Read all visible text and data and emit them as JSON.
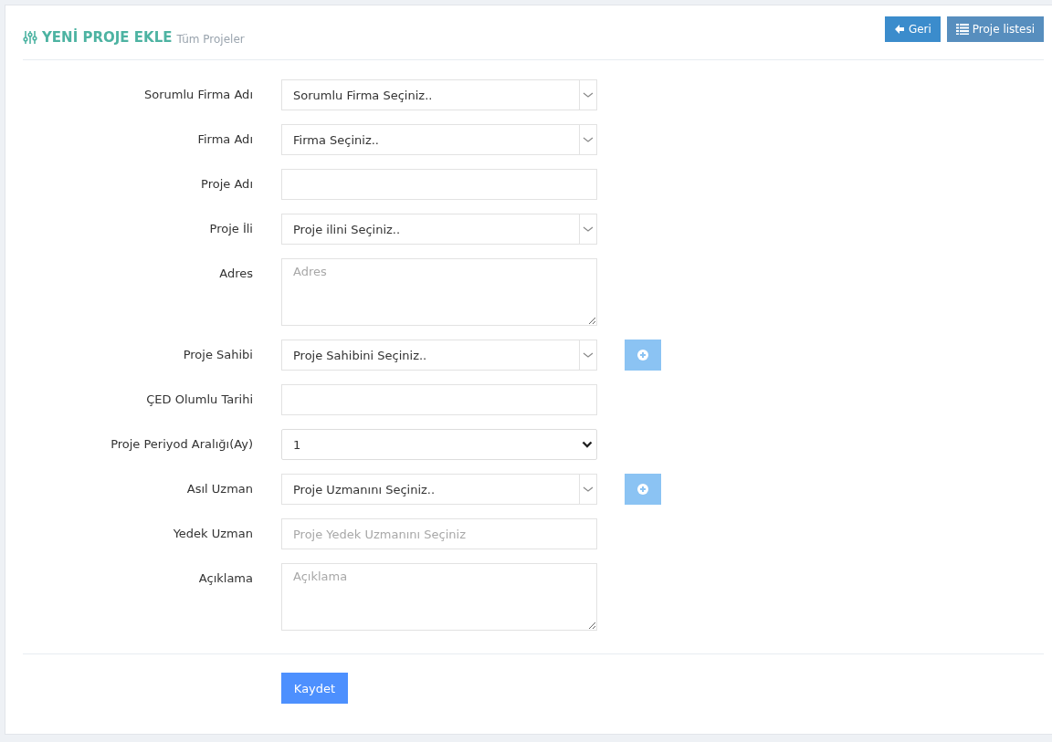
{
  "header": {
    "title": "YENİ PROJE EKLE",
    "subtitle": "Tüm Projeler",
    "buttons": [
      {
        "label": "Geri",
        "kind": "back"
      },
      {
        "label": "Proje listesi",
        "kind": "list"
      }
    ]
  },
  "fields": [
    {
      "label": "Sorumlu Firma Adı",
      "kind": "select",
      "value": "Sorumlu Firma Seçiniz..",
      "add_button": false
    },
    {
      "label": "Firma Adı",
      "kind": "select",
      "value": "Firma Seçiniz..",
      "add_button": false
    },
    {
      "label": "Proje Adı",
      "kind": "text",
      "add_button": false
    },
    {
      "label": "Proje İli",
      "kind": "select",
      "value": "Proje ilini Seçiniz..",
      "add_button": false
    },
    {
      "label": "Adres",
      "kind": "textarea",
      "placeholder": "Adres",
      "add_button": false
    },
    {
      "label": "Proje Sahibi",
      "kind": "select",
      "value": "Proje Sahibini Seçiniz..",
      "add_button": true
    },
    {
      "label": "ÇED Olumlu Tarihi",
      "kind": "text",
      "add_button": false
    },
    {
      "label": "Proje Periyod Aralığı(Ay)",
      "kind": "native",
      "value": "1",
      "add_button": false
    },
    {
      "label": "Asıl Uzman",
      "kind": "select",
      "value": "Proje Uzmanını Seçiniz..",
      "add_button": true
    },
    {
      "label": "Yedek Uzman",
      "kind": "text",
      "placeholder": "Proje Yedek Uzmanını Seçiniz",
      "add_button": false
    },
    {
      "label": "Açıklama",
      "kind": "textarea",
      "placeholder": "Açıklama",
      "add_button": false
    }
  ],
  "submit": "Kaydet"
}
